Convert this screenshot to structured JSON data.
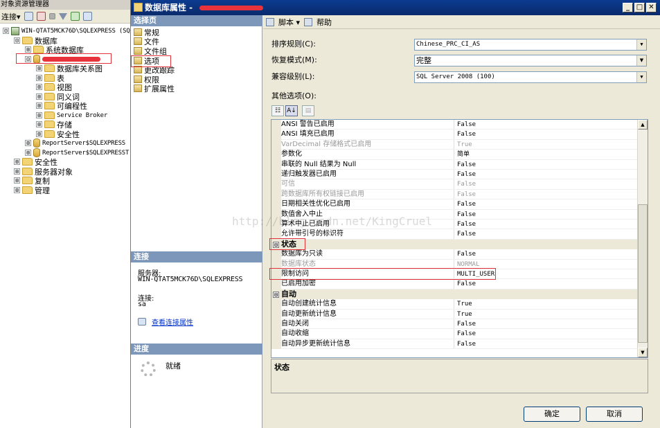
{
  "object_explorer": {
    "title": "对象资源管理器",
    "toolbar": {
      "connect_label": "连接",
      "dropdown_glyph": "▾"
    },
    "tree": [
      {
        "label": "WIN-QTAT5MCK76D\\SQLEXPRESS (SQ",
        "exp": "⊟",
        "mono": true
      },
      {
        "label": "数据库",
        "exp": "⊟"
      },
      {
        "label": "系统数据库",
        "exp": "⊞"
      },
      {
        "label": "",
        "exp": "⊟",
        "redacted": true
      },
      {
        "label": "数据库关系图",
        "exp": "⊞"
      },
      {
        "label": "表",
        "exp": "⊞"
      },
      {
        "label": "视图",
        "exp": "⊞"
      },
      {
        "label": "同义词",
        "exp": "⊞"
      },
      {
        "label": "可编程性",
        "exp": "⊞"
      },
      {
        "label": "Service Broker",
        "exp": "⊞",
        "mono": true
      },
      {
        "label": "存储",
        "exp": "⊞"
      },
      {
        "label": "安全性",
        "exp": "⊞"
      },
      {
        "label": "ReportServer$SQLEXPRESS",
        "exp": "⊞",
        "mono": true
      },
      {
        "label": "ReportServer$SQLEXPRESST",
        "exp": "⊞",
        "mono": true
      },
      {
        "label": "安全性",
        "exp": "⊞"
      },
      {
        "label": "服务器对象",
        "exp": "⊞"
      },
      {
        "label": "复制",
        "exp": "⊞"
      },
      {
        "label": "管理",
        "exp": "⊞"
      }
    ]
  },
  "dialog": {
    "title": "数据库属性 -",
    "window_buttons": {
      "minimize": "_",
      "maximize": "□",
      "close": "✕"
    },
    "select_page_header": "选择页",
    "pages": [
      "常规",
      "文件",
      "文件组",
      "选项",
      "更改跟踪",
      "权限",
      "扩展属性"
    ],
    "connection": {
      "header": "连接",
      "server_label": "服务器:",
      "server_value": "WIN-QTAT5MCK76D\\SQLEXPRESS",
      "conn_label": "连接:",
      "conn_value": "sa",
      "view_link": "查看连接属性"
    },
    "progress": {
      "header": "进度",
      "status": "就绪"
    },
    "toolbar": {
      "script_label": "脚本",
      "dropdown_glyph": "▾",
      "help_label": "帮助"
    },
    "fields": {
      "collation_label": "排序规则(C):",
      "collation_value": "Chinese_PRC_CI_AS",
      "recovery_label": "恢复模式(M):",
      "recovery_value": "完整",
      "compat_label": "兼容级别(L):",
      "compat_value": "SQL Server 2008 (100)"
    },
    "dropdown_glyph": "▼",
    "other_options_label": "其他选项(O):",
    "grid_tool_glyphs": [
      "☷",
      "A↓",
      "▤"
    ],
    "scroll_glyphs": {
      "up": "▲",
      "down": "▼"
    },
    "collapse_glyph": "⊟",
    "rows": [
      {
        "name": "ANSI 警告已启用",
        "value": "False"
      },
      {
        "name": "ANSI 填充已启用",
        "value": "False"
      },
      {
        "name": "VarDecimal 存储格式已启用",
        "value": "True",
        "disabled": true
      },
      {
        "name": "参数化",
        "value": "简单"
      },
      {
        "name": "串联的 Null 结果为 Null",
        "value": "False"
      },
      {
        "name": "递归触发器已启用",
        "value": "False"
      },
      {
        "name": "可信",
        "value": "False",
        "disabled": true
      },
      {
        "name": "跨数据库所有权链接已启用",
        "value": "False",
        "disabled": true
      },
      {
        "name": "日期相关性优化已启用",
        "value": "False"
      },
      {
        "name": "数值舍入中止",
        "value": "False"
      },
      {
        "name": "算术中止已启用",
        "value": "False"
      },
      {
        "name": "允许带引号的标识符",
        "value": "False"
      },
      {
        "category": "状态"
      },
      {
        "name": "数据库为只读",
        "value": "False"
      },
      {
        "name": "数据库状态",
        "value": "NORMAL",
        "disabled": true
      },
      {
        "name": "限制访问",
        "value": "MULTI_USER"
      },
      {
        "name": "已启用加密",
        "value": "False"
      },
      {
        "category": "自动"
      },
      {
        "name": "自动创建统计信息",
        "value": "True"
      },
      {
        "name": "自动更新统计信息",
        "value": "True"
      },
      {
        "name": "自动关闭",
        "value": "False"
      },
      {
        "name": "自动收缩",
        "value": "False"
      },
      {
        "name": "自动异步更新统计信息",
        "value": "False"
      }
    ],
    "description_title": "状态",
    "ok_label": "确定",
    "cancel_label": "取消"
  },
  "watermark": "http://blog.csdn.net/KingCruel",
  "colors": {
    "title_bar": "#0a2a6c",
    "section_header": "#7c97ba",
    "highlight_box": "#e0303a",
    "link": "#0033cc"
  }
}
